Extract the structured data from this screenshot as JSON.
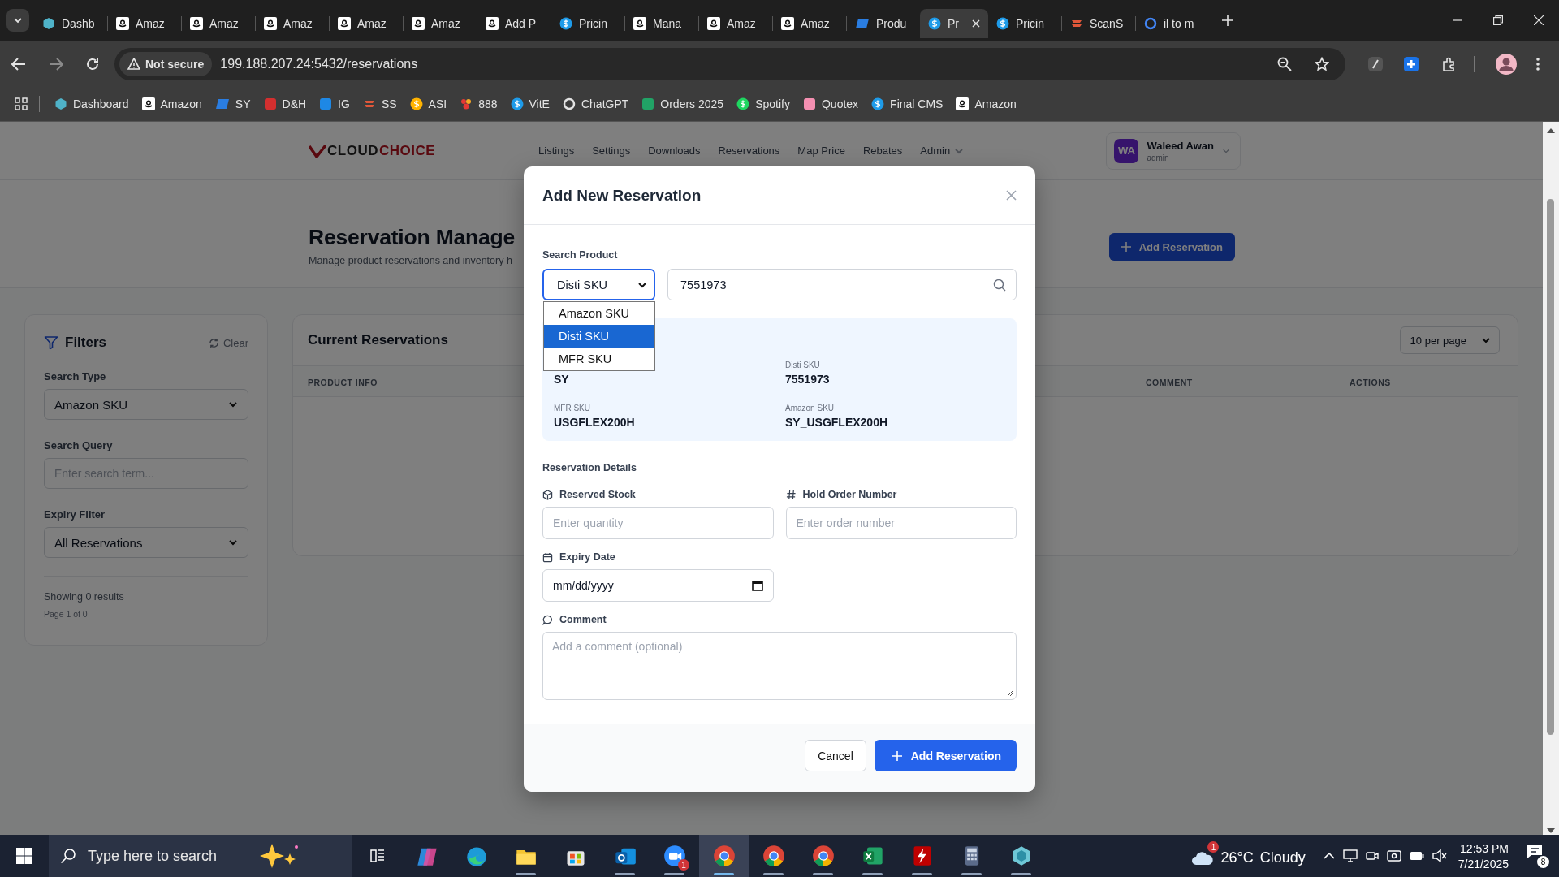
{
  "browser": {
    "tabs": [
      {
        "label": "Dashb",
        "kind": "hexagon",
        "selected": false
      },
      {
        "label": "Amaz",
        "kind": "amazon",
        "selected": false
      },
      {
        "label": "Amaz",
        "kind": "amazon",
        "selected": false
      },
      {
        "label": "Amaz",
        "kind": "amazon",
        "selected": false
      },
      {
        "label": "Amaz",
        "kind": "amazon",
        "selected": false
      },
      {
        "label": "Amaz",
        "kind": "amazon",
        "selected": false
      },
      {
        "label": "Add P",
        "kind": "amazon",
        "selected": false
      },
      {
        "label": "Pricin",
        "kind": "dollar",
        "selected": false
      },
      {
        "label": "Mana",
        "kind": "amazon",
        "selected": false
      },
      {
        "label": "Amaz",
        "kind": "amazon",
        "selected": false
      },
      {
        "label": "Amaz",
        "kind": "amazon",
        "selected": false
      },
      {
        "label": "Produ",
        "kind": "ec",
        "selected": false
      },
      {
        "label": "Pr",
        "kind": "dollar",
        "selected": true
      },
      {
        "label": "Pricin",
        "kind": "dollar",
        "selected": false
      },
      {
        "label": "ScanS",
        "kind": "stack",
        "selected": false
      },
      {
        "label": "il to m",
        "kind": "google",
        "selected": false
      }
    ],
    "address": {
      "security": "Not secure",
      "url": "199.188.207.24:5432/reservations"
    },
    "bookmarks": [
      {
        "label": "Dashboard",
        "kind": "hexagon"
      },
      {
        "label": "Amazon",
        "kind": "amazon"
      },
      {
        "label": "SY",
        "kind": "ec"
      },
      {
        "label": "D&H",
        "kind": "dh"
      },
      {
        "label": "IG",
        "kind": "ig"
      },
      {
        "label": "SS",
        "kind": "stack"
      },
      {
        "label": "ASI",
        "kind": "asi"
      },
      {
        "label": "888",
        "kind": "dots"
      },
      {
        "label": "VitE",
        "kind": "dollar"
      },
      {
        "label": "ChatGPT",
        "kind": "knot"
      },
      {
        "label": "Orders 2025",
        "kind": "sheet"
      },
      {
        "label": "Spotify",
        "kind": "spotify"
      },
      {
        "label": "Quotex",
        "kind": "quotex"
      },
      {
        "label": "Final CMS",
        "kind": "dollar"
      },
      {
        "label": "Amazon",
        "kind": "amazon"
      }
    ]
  },
  "app": {
    "logo": {
      "first": "CLOUD",
      "second": "CHOICE"
    },
    "nav": [
      {
        "label": "Listings",
        "kind": "link"
      },
      {
        "label": "Settings",
        "kind": "link"
      },
      {
        "label": "Downloads",
        "kind": "link"
      },
      {
        "label": "Reservations",
        "kind": "link"
      },
      {
        "label": "Map Price",
        "kind": "link"
      },
      {
        "label": "Rebates",
        "kind": "link"
      },
      {
        "label": "Admin",
        "kind": "menu"
      }
    ],
    "user": {
      "initials": "WA",
      "name": "Waleed Awan",
      "role": "admin"
    },
    "title": "Reservation Manage",
    "subtitle": "Manage product reservations and inventory h",
    "add_button": "Add Reservation",
    "filters": {
      "title": "Filters",
      "clear": "Clear",
      "search_type": {
        "label": "Search Type",
        "value": "Amazon SKU"
      },
      "search_query": {
        "label": "Search Query",
        "placeholder": "Enter search term..."
      },
      "expiry": {
        "label": "Expiry Filter",
        "value": "All Reservations"
      },
      "results": "Showing 0 results",
      "page": "Page 1 of 0"
    },
    "reservations": {
      "title": "Current Reservations",
      "page_size": "10 per page",
      "columns": [
        "PRODUCT INFO",
        "COMMENT",
        "ACTIONS"
      ]
    }
  },
  "modal": {
    "title": "Add New Reservation",
    "search_label": "Search Product",
    "search_type": {
      "value": "Disti SKU",
      "expanded": true,
      "options": [
        {
          "label": "Amazon SKU",
          "selected": false
        },
        {
          "label": "Disti SKU",
          "selected": true
        },
        {
          "label": "MFR SKU",
          "selected": false
        }
      ]
    },
    "search_value": "7551973",
    "product": {
      "first_value": "SY",
      "fields": [
        {
          "label": "Disti SKU",
          "value": "7551973"
        },
        {
          "label": "MFR SKU",
          "value": "USGFLEX200H"
        },
        {
          "label": "Amazon SKU",
          "value": "SY_USGFLEX200H"
        }
      ]
    },
    "details_label": "Reservation Details",
    "reserved_stock": {
      "label": "Reserved Stock",
      "placeholder": "Enter quantity"
    },
    "hold_order": {
      "label": "Hold Order Number",
      "placeholder": "Enter order number"
    },
    "expiry_date": {
      "label": "Expiry Date",
      "placeholder": "mm/dd/yyyy"
    },
    "comment": {
      "label": "Comment",
      "placeholder": "Add a comment (optional)"
    },
    "cancel": "Cancel",
    "submit": "Add Reservation"
  },
  "taskbar": {
    "search_placeholder": "Type here to search",
    "apps": [
      {
        "kind": "copilot",
        "running": false,
        "selected": false
      },
      {
        "kind": "edge",
        "running": false,
        "selected": false
      },
      {
        "kind": "explorer",
        "running": true,
        "selected": false
      },
      {
        "kind": "store",
        "running": false,
        "selected": false
      },
      {
        "kind": "outlook",
        "running": true,
        "selected": false
      },
      {
        "kind": "zoom",
        "running": true,
        "selected": false,
        "badge": "1"
      },
      {
        "kind": "chrome",
        "running": true,
        "selected": true
      },
      {
        "kind": "chrome",
        "running": true,
        "selected": false
      },
      {
        "kind": "chrome",
        "running": true,
        "selected": false
      },
      {
        "kind": "excel",
        "running": true,
        "selected": false
      },
      {
        "kind": "filezilla",
        "running": true,
        "selected": false
      },
      {
        "kind": "calculator",
        "running": true,
        "selected": false
      },
      {
        "kind": "hexagon",
        "running": true,
        "selected": false
      }
    ],
    "weather": {
      "badge": "1",
      "temp": "26°C",
      "condition": "Cloudy"
    },
    "time": "12:53 PM",
    "date": "7/21/2025",
    "notifications": "8"
  }
}
